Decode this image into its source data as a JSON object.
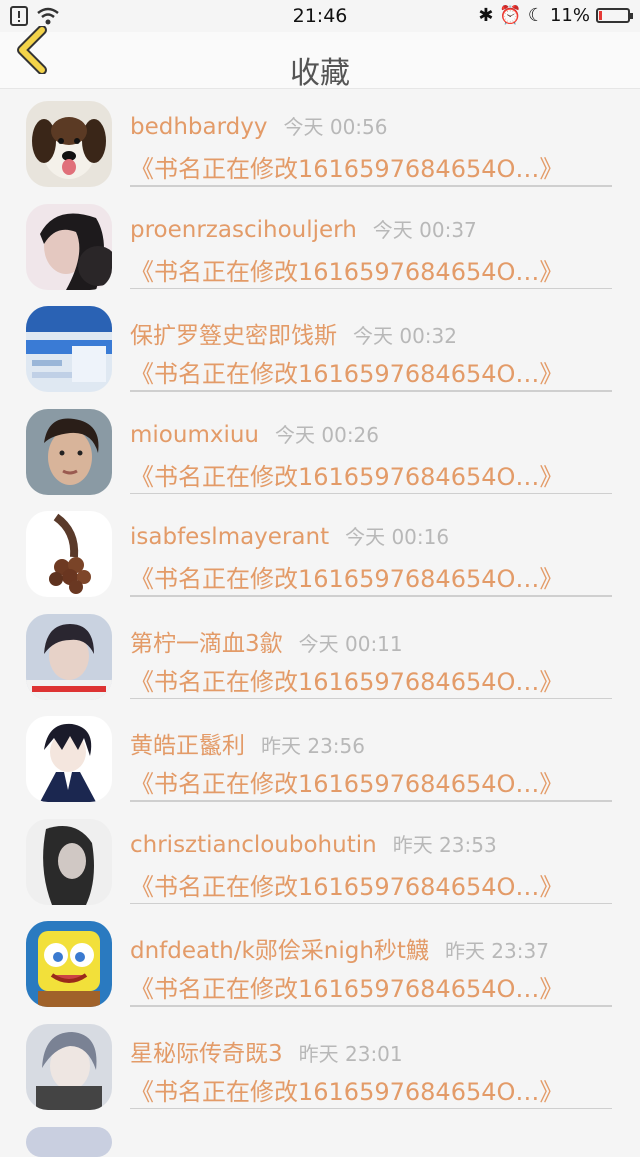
{
  "status_bar": {
    "time": "21:46",
    "battery": "11%",
    "battery_level": 0.11
  },
  "nav": {
    "title": "收藏",
    "back_icon": "chevron-left-icon"
  },
  "items": [
    {
      "name": "bedhbardyy",
      "time": "今天 00:56",
      "book": "《书名正在修改1616597684654O…》"
    },
    {
      "name": "proenrzascihouljerh",
      "time": "今天 00:37",
      "book": "《书名正在修改1616597684654O…》"
    },
    {
      "name": "保扩罗簦史密即饯斯",
      "time": "今天 00:32",
      "book": "《书名正在修改1616597684654O…》"
    },
    {
      "name": "mioumxiuu",
      "time": "今天 00:26",
      "book": "《书名正在修改1616597684654O…》"
    },
    {
      "name": "isabfeslmayerant",
      "time": "今天 00:16",
      "book": "《书名正在修改1616597684654O…》"
    },
    {
      "name": "第柠一滴血3歙",
      "time": "今天 00:11",
      "book": "《书名正在修改1616597684654O…》"
    },
    {
      "name": "黄皓正鬣利",
      "time": "昨天 23:56",
      "book": "《书名正在修改1616597684654O…》"
    },
    {
      "name": "chrisztiancloubohutin",
      "time": "昨天 23:53",
      "book": "《书名正在修改1616597684654O…》"
    },
    {
      "name": "dnfdeath/k郧侩采nigh秒t鱴",
      "time": "昨天 23:37",
      "book": "《书名正在修改1616597684654O…》"
    },
    {
      "name": "星秘际传奇既3",
      "time": "昨天 23:01",
      "book": "《书名正在修改1616597684654O…》"
    }
  ]
}
